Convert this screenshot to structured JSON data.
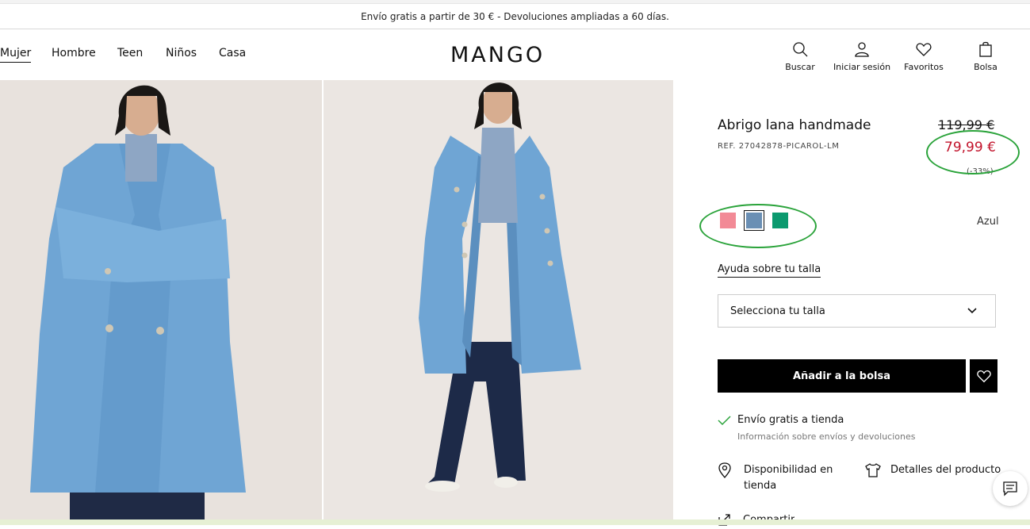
{
  "promo": {
    "text": "Envío gratis a partir de 30 € - Devoluciones ampliadas a 60 días."
  },
  "nav": {
    "links": [
      "Mujer",
      "Hombre",
      "Teen",
      "Niños",
      "Casa"
    ],
    "logo": "MANGO",
    "utilities": [
      "Buscar",
      "Iniciar sesión",
      "Favoritos",
      "Bolsa"
    ]
  },
  "product": {
    "title": "Abrigo lana handmade",
    "ref": "REF. 27042878-PICAROL-LM",
    "old_price": "119,99 €",
    "new_price": "79,99 €",
    "discount": "(-33%)",
    "color_name": "Azul",
    "swatch_colors": [
      "#f28a96",
      "#6a8fb4",
      "#0c9a6f"
    ],
    "size_help": "Ayuda sobre tu talla",
    "size_placeholder": "Selecciona tu talla",
    "add_to_bag": "Añadir a la bolsa",
    "shipping_title": "Envío gratis a tienda",
    "shipping_sub": "Información sobre envíos y devoluciones",
    "availability": "Disponibilidad en tienda",
    "details": "Detalles del producto",
    "share": "Compartir"
  },
  "colors": {
    "price_red": "#c2132b",
    "annotation_green": "#2aa33a",
    "coat_blue": "#6fa5d4"
  }
}
